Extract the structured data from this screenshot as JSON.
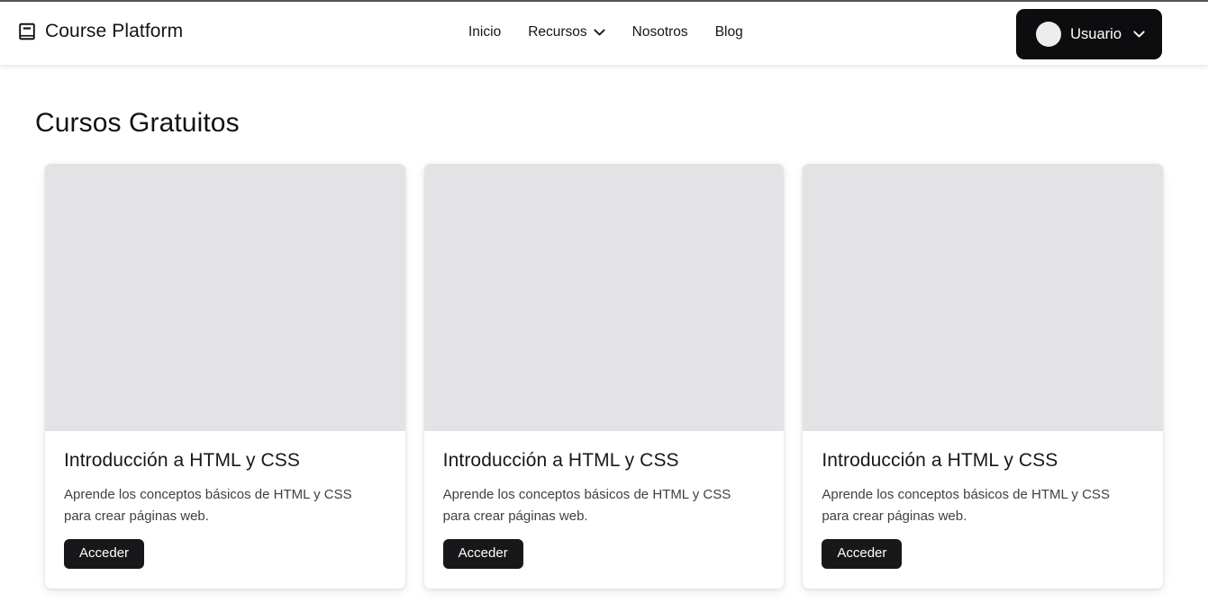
{
  "header": {
    "brand": {
      "icon": "book-icon",
      "label": "Course Platform"
    },
    "nav_items": [
      {
        "label": "Inicio",
        "has_dropdown": false
      },
      {
        "label": "Recursos",
        "has_dropdown": true,
        "icon": "chevron-down-icon"
      },
      {
        "label": "Nosotros",
        "has_dropdown": false
      },
      {
        "label": "Blog",
        "has_dropdown": false
      }
    ],
    "user_menu": {
      "avatar": "avatar-circle",
      "label": "Usuario",
      "icon": "chevron-down-icon",
      "background_color": "#0d0d0f",
      "text_color": "#ffffff"
    }
  },
  "main": {
    "page_title": "Cursos Gratuitos",
    "cards": [
      {
        "media": "course-thumbnail-placeholder",
        "title": "Introducción a HTML y CSS",
        "description": "Aprende los conceptos básicos de HTML y CSS para crear páginas web.",
        "button_label": "Acceder"
      },
      {
        "media": "course-thumbnail-placeholder",
        "title": "Introducción a HTML y CSS",
        "description": "Aprende los conceptos básicos de HTML y CSS para crear páginas web.",
        "button_label": "Acceder"
      },
      {
        "media": "course-thumbnail-placeholder",
        "title": "Introducción a HTML y CSS",
        "description": "Aprende los conceptos básicos de HTML y CSS para crear páginas web.",
        "button_label": "Acceder"
      }
    ]
  },
  "colors": {
    "page_background": "#ffffff",
    "header_background": "#ffffff",
    "accent_dark": "#18181b",
    "media_placeholder": "#e3e3e5",
    "text_primary": "#18181a",
    "text_secondary": "#3f4044"
  }
}
